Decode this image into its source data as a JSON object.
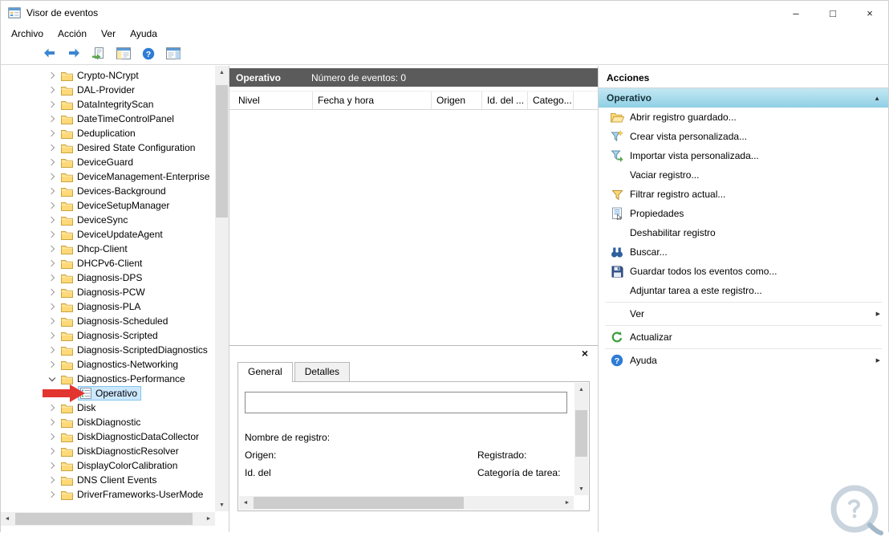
{
  "window": {
    "title": "Visor de eventos",
    "controls": {
      "minimize": "–",
      "maximize": "□",
      "close": "×"
    }
  },
  "menu": {
    "items": [
      "Archivo",
      "Acción",
      "Ver",
      "Ayuda"
    ]
  },
  "toolbar": {
    "buttons": [
      {
        "icon": "back-icon"
      },
      {
        "icon": "forward-icon"
      },
      {
        "icon": "export-icon"
      },
      {
        "icon": "console-tree-icon"
      },
      {
        "icon": "help-icon"
      },
      {
        "icon": "action-pane-icon"
      }
    ]
  },
  "tree": {
    "items": [
      {
        "label": "Crypto-NCrypt",
        "state": "collapsed",
        "icon": "folder"
      },
      {
        "label": "DAL-Provider",
        "state": "collapsed",
        "icon": "folder"
      },
      {
        "label": "DataIntegrityScan",
        "state": "collapsed",
        "icon": "folder"
      },
      {
        "label": "DateTimeControlPanel",
        "state": "collapsed",
        "icon": "folder"
      },
      {
        "label": "Deduplication",
        "state": "collapsed",
        "icon": "folder"
      },
      {
        "label": "Desired State Configuration",
        "state": "collapsed",
        "icon": "folder"
      },
      {
        "label": "DeviceGuard",
        "state": "collapsed",
        "icon": "folder"
      },
      {
        "label": "DeviceManagement-Enterprise",
        "state": "collapsed",
        "icon": "folder"
      },
      {
        "label": "Devices-Background",
        "state": "collapsed",
        "icon": "folder"
      },
      {
        "label": "DeviceSetupManager",
        "state": "collapsed",
        "icon": "folder"
      },
      {
        "label": "DeviceSync",
        "state": "collapsed",
        "icon": "folder"
      },
      {
        "label": "DeviceUpdateAgent",
        "state": "collapsed",
        "icon": "folder"
      },
      {
        "label": "Dhcp-Client",
        "state": "collapsed",
        "icon": "folder"
      },
      {
        "label": "DHCPv6-Client",
        "state": "collapsed",
        "icon": "folder"
      },
      {
        "label": "Diagnosis-DPS",
        "state": "collapsed",
        "icon": "folder"
      },
      {
        "label": "Diagnosis-PCW",
        "state": "collapsed",
        "icon": "folder"
      },
      {
        "label": "Diagnosis-PLA",
        "state": "collapsed",
        "icon": "folder"
      },
      {
        "label": "Diagnosis-Scheduled",
        "state": "collapsed",
        "icon": "folder"
      },
      {
        "label": "Diagnosis-Scripted",
        "state": "collapsed",
        "icon": "folder"
      },
      {
        "label": "Diagnosis-ScriptedDiagnostics",
        "state": "collapsed",
        "icon": "folder"
      },
      {
        "label": "Diagnostics-Networking",
        "state": "collapsed",
        "icon": "folder"
      },
      {
        "label": "Diagnostics-Performance",
        "state": "expanded",
        "icon": "folder"
      },
      {
        "label": "Operativo",
        "icon": "event-log",
        "indent": 1,
        "selected": true
      },
      {
        "label": "Disk",
        "state": "collapsed",
        "icon": "folder"
      },
      {
        "label": "DiskDiagnostic",
        "state": "collapsed",
        "icon": "folder"
      },
      {
        "label": "DiskDiagnosticDataCollector",
        "state": "collapsed",
        "icon": "folder"
      },
      {
        "label": "DiskDiagnosticResolver",
        "state": "collapsed",
        "icon": "folder"
      },
      {
        "label": "DisplayColorCalibration",
        "state": "collapsed",
        "icon": "folder"
      },
      {
        "label": "DNS Client Events",
        "state": "collapsed",
        "icon": "folder"
      },
      {
        "label": "DriverFrameworks-UserMode",
        "state": "collapsed",
        "icon": "folder"
      }
    ]
  },
  "main": {
    "header": {
      "title": "Operativo",
      "events_count": "Número de eventos: 0"
    },
    "table": {
      "columns": [
        "Nivel",
        "Fecha y hora",
        "Origen",
        "Id. del ...",
        "Catego..."
      ]
    },
    "preview": {
      "tabs": [
        "General",
        "Detalles"
      ],
      "close_glyph": "×",
      "description_value": "",
      "log_name_label": "Nombre de registro:",
      "source_label": "Origen:",
      "logged_label": "Registrado:",
      "event_id_label": "Id. del",
      "task_category_label": "Categoría de tarea:"
    }
  },
  "actions": {
    "title": "Acciones",
    "section": "Operativo",
    "collapse_glyph": "▲",
    "submenu_glyph": "▶",
    "items": [
      {
        "label": "Abrir registro guardado...",
        "icon": "open-saved-log-icon"
      },
      {
        "label": "Crear vista personalizada...",
        "icon": "create-custom-view-icon"
      },
      {
        "label": "Importar vista personalizada...",
        "icon": "import-custom-view-icon"
      },
      {
        "label": "Vaciar registro..."
      },
      {
        "label": "Filtrar registro actual...",
        "icon": "filter-icon"
      },
      {
        "label": "Propiedades",
        "icon": "properties-icon"
      },
      {
        "label": "Deshabilitar registro"
      },
      {
        "label": "Buscar...",
        "icon": "find-icon"
      },
      {
        "label": "Guardar todos los eventos como...",
        "icon": "save-icon"
      },
      {
        "label": "Adjuntar tarea a este registro..."
      },
      {
        "label": "Ver",
        "submenu": true,
        "separator_before": true
      },
      {
        "label": "Actualizar",
        "icon": "refresh-icon",
        "separator_before": true
      },
      {
        "label": "Ayuda",
        "icon": "help-icon",
        "submenu": true,
        "separator_before": true
      }
    ]
  },
  "scrollbars": {
    "up": "▲",
    "down": "▼",
    "left": "◄",
    "right": "►"
  },
  "colors": {
    "accent_blue": "#3c86d2",
    "selection": "#cce8ff",
    "list_header": "#5b5b5b",
    "actions_header": "#8fd0e5",
    "annotation_red": "#e23530"
  }
}
